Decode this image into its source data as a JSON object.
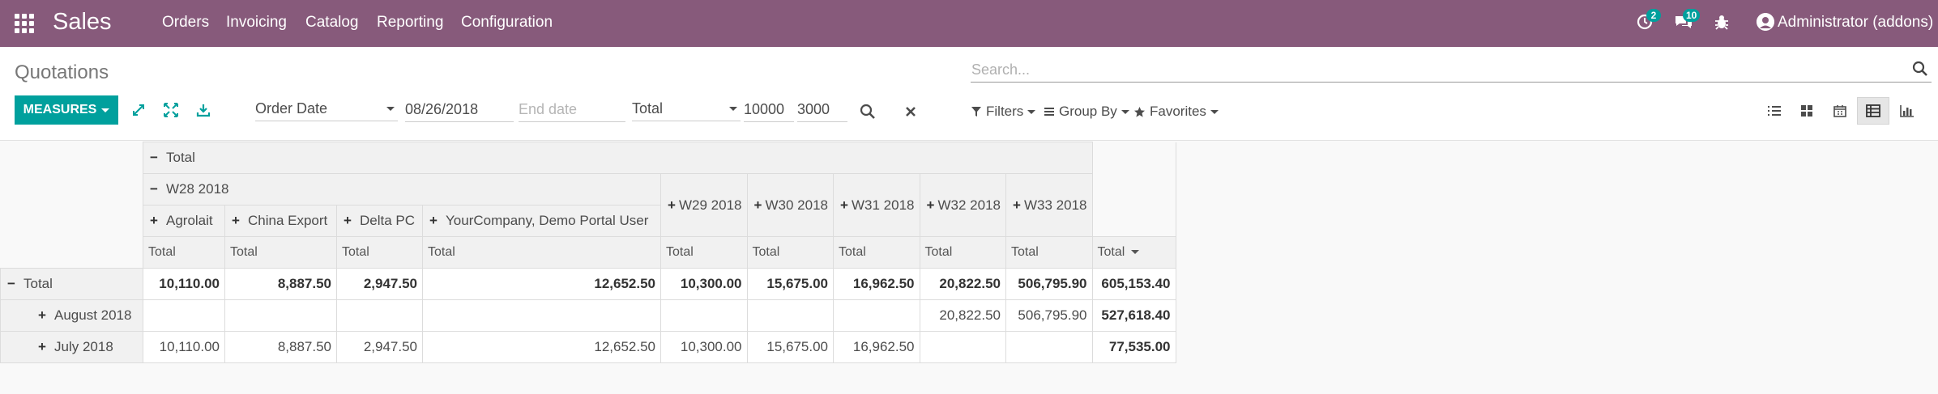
{
  "navbar": {
    "app_name": "Sales",
    "menu": [
      "Orders",
      "Invoicing",
      "Catalog",
      "Reporting",
      "Configuration"
    ],
    "activity_badge": "2",
    "messages_badge": "10",
    "user": "Administrator (addons)"
  },
  "control_panel": {
    "breadcrumb": "Quotations",
    "search_placeholder": "Search...",
    "measures_label": "MEASURES",
    "date_field": "Order Date",
    "start_date": "08/26/2018",
    "end_date_placeholder": "End date",
    "total_select": "Total",
    "value_1": "10000",
    "value_2": "3000",
    "filters_label": "Filters",
    "group_by_label": "Group By",
    "favorites_label": "Favorites"
  },
  "pivot": {
    "header_total": "Total",
    "week_group": "W28 2018",
    "partners": [
      "Agrolait",
      "China Export",
      "Delta PC",
      "YourCompany, Demo Portal User"
    ],
    "weeks": [
      "W29 2018",
      "W30 2018",
      "W31 2018",
      "W32 2018",
      "W33 2018"
    ],
    "measure_label": "Total",
    "total_col_label": "Total",
    "rows": [
      {
        "label": "Total",
        "values": [
          "10,110.00",
          "8,887.50",
          "2,947.50",
          "12,652.50",
          "10,300.00",
          "15,675.00",
          "16,962.50",
          "20,822.50",
          "506,795.90",
          "605,153.40"
        ]
      },
      {
        "label": "August 2018",
        "values": [
          "",
          "",
          "",
          "",
          "",
          "",
          "",
          "20,822.50",
          "506,795.90",
          "527,618.40"
        ]
      },
      {
        "label": "July 2018",
        "values": [
          "10,110.00",
          "8,887.50",
          "2,947.50",
          "12,652.50",
          "10,300.00",
          "15,675.00",
          "16,962.50",
          "",
          "",
          "77,535.00"
        ]
      }
    ]
  },
  "colors": {
    "navbar": "#875a7b",
    "primary": "#00a09d"
  }
}
